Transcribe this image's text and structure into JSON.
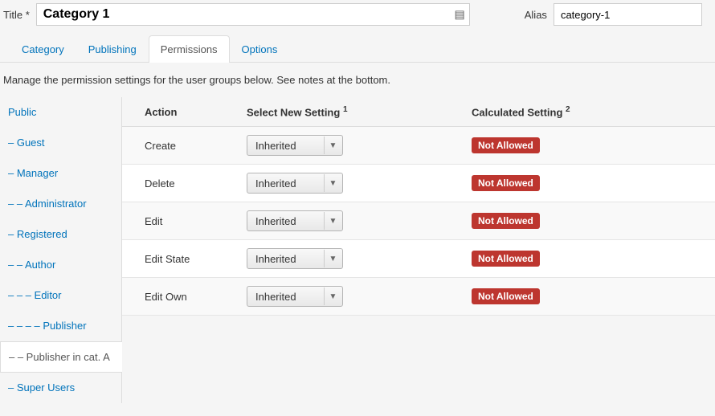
{
  "fields": {
    "title_label": "Title *",
    "title_value": "Category 1",
    "alias_label": "Alias",
    "alias_value": "category-1"
  },
  "tabs": [
    "Category",
    "Publishing",
    "Permissions",
    "Options"
  ],
  "active_tab_index": 2,
  "help_text": "Manage the permission settings for the user groups below. See notes at the bottom.",
  "groups": [
    "Public",
    "– Guest",
    "– Manager",
    "– – Administrator",
    "– Registered",
    "– – Author",
    "– – – Editor",
    "– – – – Publisher",
    "– – Publisher in cat. A",
    "– Super Users"
  ],
  "active_group_index": 8,
  "columns": {
    "action": "Action",
    "select": "Select New Setting",
    "sup1": "1",
    "calc": "Calculated Setting",
    "sup2": "2"
  },
  "select_option": "Inherited",
  "badge_text": "Not Allowed",
  "rows": [
    {
      "action": "Create"
    },
    {
      "action": "Delete"
    },
    {
      "action": "Edit"
    },
    {
      "action": "Edit State"
    },
    {
      "action": "Edit Own"
    }
  ]
}
